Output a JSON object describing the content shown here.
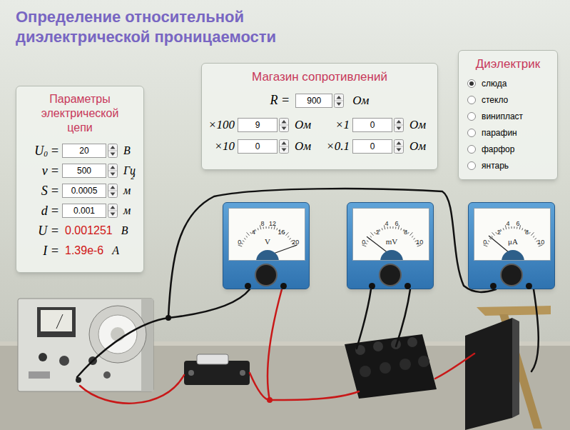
{
  "title_lines": [
    "Определение относительной",
    "диэлектрической проницаемости"
  ],
  "circuit": {
    "title": "Параметры электрической цепи",
    "inputs": [
      {
        "label": "U",
        "sub": "0",
        "eq": "=",
        "value": "20",
        "unit": "В",
        "sup": ""
      },
      {
        "label": "ν",
        "sub": "",
        "eq": "=",
        "value": "500",
        "unit": "Гц",
        "sup": ""
      },
      {
        "label": "S",
        "sub": "",
        "eq": "=",
        "value": "0.0005",
        "unit": "м",
        "sup": "2"
      },
      {
        "label": "d",
        "sub": "",
        "eq": "=",
        "value": "0.001",
        "unit": "м",
        "sup": ""
      }
    ],
    "outputs": [
      {
        "label": "U =",
        "value": "0.001251",
        "unit": "В"
      },
      {
        "label": "I =",
        "value": "1.39e-6",
        "unit": "А"
      }
    ]
  },
  "resistance": {
    "title": "Магазин сопротивлений",
    "total": {
      "label": "R =",
      "value": "900",
      "unit": "Ом"
    },
    "decades": [
      {
        "label": "×100",
        "value": "9",
        "unit": "Ом"
      },
      {
        "label": "×1",
        "value": "0",
        "unit": "Ом"
      },
      {
        "label": "×10",
        "value": "0",
        "unit": "Ом"
      },
      {
        "label": "×0.1",
        "value": "0",
        "unit": "Ом"
      }
    ]
  },
  "dielectric": {
    "title": "Диэлектрик",
    "options": [
      {
        "label": "слюда",
        "selected": true
      },
      {
        "label": "стекло",
        "selected": false
      },
      {
        "label": "винипласт",
        "selected": false
      },
      {
        "label": "парафин",
        "selected": false
      },
      {
        "label": "фарфор",
        "selected": false
      },
      {
        "label": "янтарь",
        "selected": false
      }
    ]
  },
  "meters": [
    {
      "unit": "V",
      "ticks": [
        "0",
        "4",
        "8",
        "12",
        "16",
        "20"
      ],
      "level": 1.0
    },
    {
      "unit": "mV",
      "ticks": [
        "0",
        "2",
        "4",
        "6",
        "8",
        "10"
      ],
      "level": 0.125
    },
    {
      "unit": "μA",
      "ticks": [
        "0",
        "2",
        "4",
        "6",
        "8",
        "10"
      ],
      "level": 0.139
    }
  ]
}
